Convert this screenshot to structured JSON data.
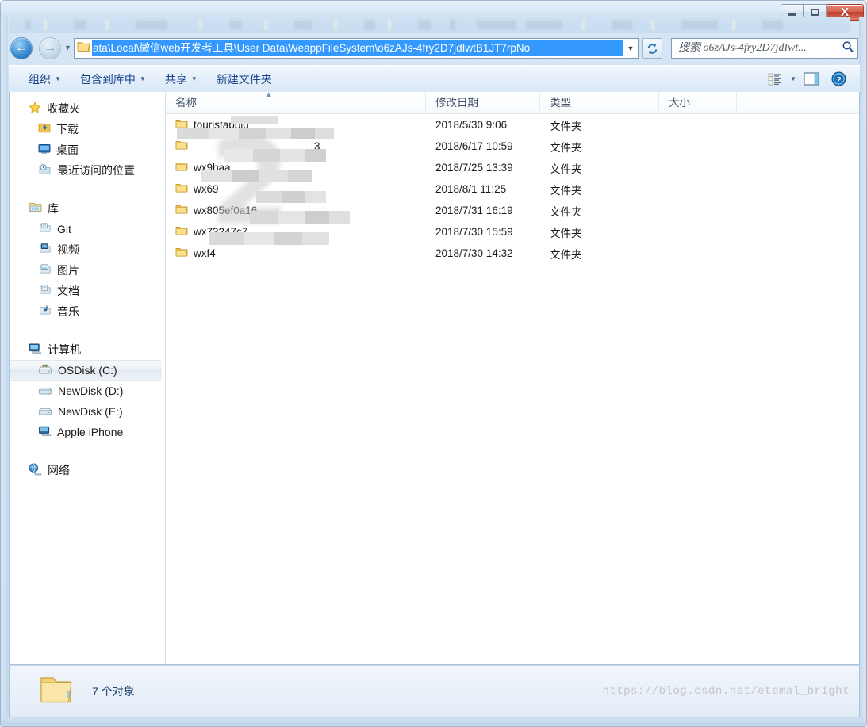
{
  "window": {
    "controls": {
      "minimize": "—",
      "maximize": "□",
      "close": "X"
    }
  },
  "navbar": {
    "back_arrow": "←",
    "forward_arrow": "→",
    "history_caret": "▼",
    "address_value": "ata\\Local\\微信web开发者工具\\User Data\\WeappFileSystem\\o6zAJs-4fry2D7jdIwtB1JT7rpNo",
    "address_caret": "▼",
    "refresh_glyph": "↻",
    "search_placeholder": "搜索 o6zAJs-4fry2D7jdIwt...",
    "search_value": ""
  },
  "toolbar": {
    "items": [
      {
        "label": "组织",
        "caret": "▼"
      },
      {
        "label": "包含到库中",
        "caret": "▼"
      },
      {
        "label": "共享",
        "caret": "▼"
      },
      {
        "label": "新建文件夹",
        "caret": ""
      }
    ],
    "view_caret": "▼",
    "help_glyph": "?"
  },
  "sidebar": {
    "groups": [
      {
        "head": {
          "label": "收藏夹",
          "icon": "star-icon"
        },
        "items": [
          {
            "label": "下载",
            "icon": "downloads-icon",
            "selected": false
          },
          {
            "label": "桌面",
            "icon": "desktop-icon",
            "selected": false
          },
          {
            "label": "最近访问的位置",
            "icon": "recent-places-icon",
            "selected": false
          }
        ]
      },
      {
        "head": {
          "label": "库",
          "icon": "libraries-icon"
        },
        "items": [
          {
            "label": "Git",
            "icon": "library-icon",
            "selected": false
          },
          {
            "label": "视频",
            "icon": "videos-icon",
            "selected": false
          },
          {
            "label": "图片",
            "icon": "pictures-icon",
            "selected": false
          },
          {
            "label": "文档",
            "icon": "documents-icon",
            "selected": false
          },
          {
            "label": "音乐",
            "icon": "music-icon",
            "selected": false
          }
        ]
      },
      {
        "head": {
          "label": "计算机",
          "icon": "computer-icon"
        },
        "items": [
          {
            "label": "OSDisk (C:)",
            "icon": "system-drive-icon",
            "selected": true
          },
          {
            "label": "NewDisk (D:)",
            "icon": "drive-icon",
            "selected": false
          },
          {
            "label": "NewDisk (E:)",
            "icon": "drive-icon",
            "selected": false
          },
          {
            "label": "Apple iPhone",
            "icon": "phone-device-icon",
            "selected": false
          }
        ]
      },
      {
        "head": {
          "label": "网络",
          "icon": "network-icon"
        },
        "items": []
      }
    ]
  },
  "filelist": {
    "columns": [
      {
        "key": "name",
        "label": "名称",
        "sorted": true,
        "sort_glyph": "▲"
      },
      {
        "key": "date",
        "label": "修改日期"
      },
      {
        "key": "type",
        "label": "类型"
      },
      {
        "key": "size",
        "label": "大小"
      }
    ],
    "rows": [
      {
        "name": "touristappid",
        "date": "2018/5/30 9:06",
        "type": "文件夹",
        "size": "",
        "redacted": true
      },
      {
        "name": "3",
        "date": "2018/6/17 10:59",
        "type": "文件夹",
        "size": "",
        "redacted": true
      },
      {
        "name": "wx9baa",
        "date": "2018/7/25 13:39",
        "type": "文件夹",
        "size": "",
        "redacted": true
      },
      {
        "name": "wx69",
        "date": "2018/8/1 11:25",
        "type": "文件夹",
        "size": "",
        "redacted": true
      },
      {
        "name": "wx805ef0a16",
        "date": "2018/7/31 16:19",
        "type": "文件夹",
        "size": "",
        "redacted": true
      },
      {
        "name": "wx73247c7",
        "date": "2018/7/30 15:59",
        "type": "文件夹",
        "size": "",
        "redacted": true
      },
      {
        "name": "wxf4",
        "date": "2018/7/30 14:32",
        "type": "文件夹",
        "size": "",
        "redacted": true
      }
    ]
  },
  "statusbar": {
    "text": "7 个对象",
    "watermark": "https://blog.csdn.net/etemal_bright"
  },
  "colors": {
    "selection_blue": "#3399ff",
    "toolbar_text": "#15428b",
    "close_red": "#bc3b27",
    "folder_yellow": "#f6cf6a"
  }
}
